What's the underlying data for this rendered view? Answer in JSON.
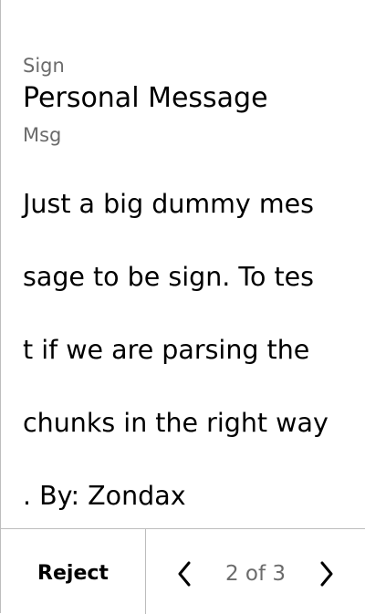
{
  "review": {
    "field1": {
      "label": "Sign",
      "value": "Personal Message"
    },
    "field2": {
      "label": "Msg",
      "lines": [
        "Just a big dummy mes",
        "sage to be sign. To tes",
        "t if we are parsing the",
        "chunks in the right way",
        ". By: Zondax"
      ]
    }
  },
  "footer": {
    "reject_label": "Reject",
    "page_indicator": "2 of 3",
    "prev_icon": "chevron-left-icon",
    "next_icon": "chevron-right-icon"
  },
  "colors": {
    "text": "#000000",
    "muted": "#6b6b6b",
    "divider": "#bdbdbd",
    "background": "#ffffff"
  }
}
